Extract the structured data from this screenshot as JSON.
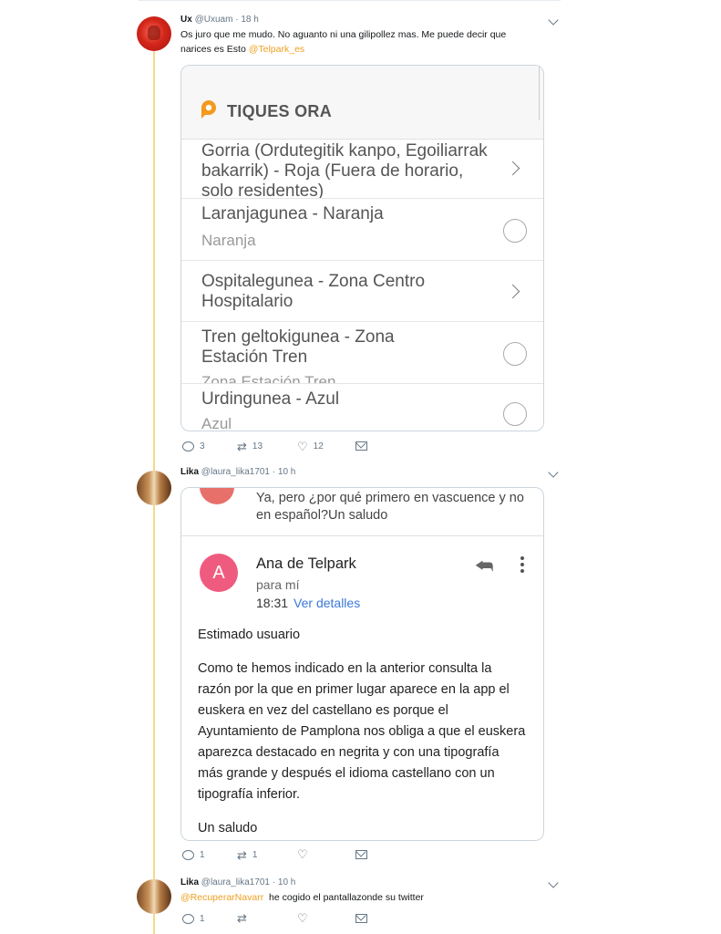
{
  "tweets": [
    {
      "name": "Ux",
      "handle": "@Uxuam",
      "dot": "·",
      "time": "18 h",
      "text_line1": "Os juro que me mudo. No aguanto ni una gilipollez mas. Me puede decir que",
      "text_line2": "narices es Esto",
      "mention": "@Telpark_es",
      "replies": "3",
      "retweets": "13",
      "likes": "12"
    },
    {
      "name": "Lika",
      "handle": "@laura_lika1701",
      "dot": "·",
      "time": "10 h",
      "replies": "1",
      "retweets": "1",
      "likes": ""
    },
    {
      "name": "Lika",
      "handle": "@laura_lika1701",
      "dot": "·",
      "time": "10 h",
      "mention": "@RecuperarNavarr",
      "text": "he cogido el pantallazonde su twitter",
      "replies": "1",
      "retweets": "",
      "likes": ""
    }
  ],
  "telpark": {
    "title": "TIQUES ORA",
    "rows": [
      {
        "main": "Gorria (Ordutegitik kanpo, Egoiliarrak bakarrik) - Roja (Fuera de horario, solo residentes)",
        "sub": "",
        "control": "arrow"
      },
      {
        "main": "Laranjagunea - Naranja",
        "sub": "Naranja",
        "control": "radio"
      },
      {
        "main": "Ospitalegunea - Zona Centro Hospitalario",
        "sub": "",
        "control": "arrow"
      },
      {
        "main": "Tren geltokigunea - Zona Estación Tren",
        "sub": "Zona Estación Tren",
        "control": "radio"
      },
      {
        "main": "Urdingunea - Azul",
        "sub": "Azul",
        "control": "radio"
      }
    ]
  },
  "email": {
    "preview_text": "Ya, pero ¿por qué primero en vascuence y no en español?Un saludo",
    "avatar_letter": "A",
    "from": "Ana de Telpark",
    "to": "para mí",
    "time": "18:31",
    "details_link": "Ver detalles",
    "greeting": "Estimado usuario",
    "body": "Como te hemos indicado en la anterior consulta la razón por la que en primer lugar aparece en la app el euskera en vez del castellano es porque el Ayuntamiento de Pamplona nos obliga a que el euskera aparezca destacado en negrita y con una tipografía más grande y después el idioma castellano con un tipografía inferior.",
    "signoff": "Un saludo"
  },
  "icons": [
    "reply-icon",
    "retweet-icon",
    "like-icon",
    "message-icon",
    "chevron-down-icon",
    "telpark-logo-icon",
    "reply-arrow-icon",
    "more-vert-icon"
  ],
  "colors": {
    "mention": "#f0a020",
    "thread_line": "#f5d889",
    "link": "#3b78d8",
    "avatar_pink": "#ef5b7f"
  }
}
